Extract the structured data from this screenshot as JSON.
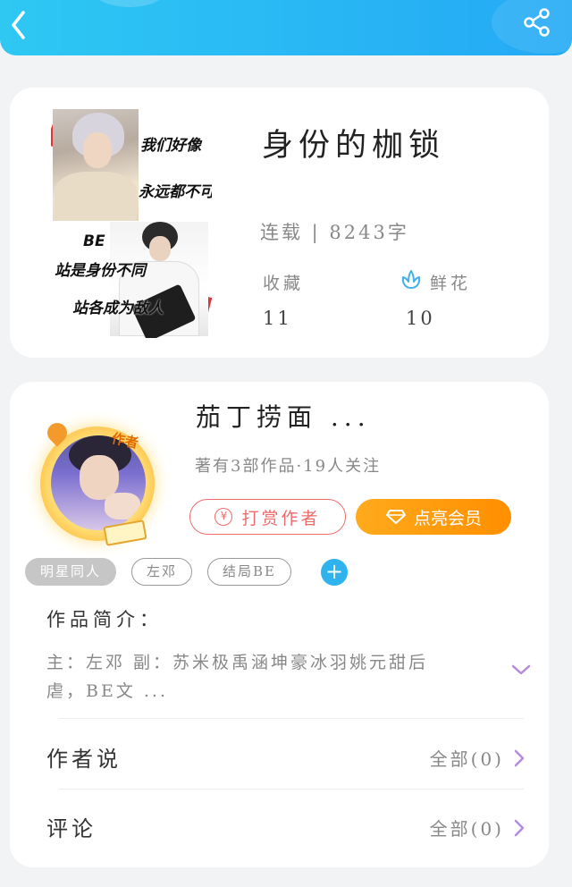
{
  "header": {
    "back_icon": "chevron-left-icon",
    "share_icon": "share-icon",
    "colors": {
      "start": "#2ec8f3",
      "end": "#24a9f5"
    }
  },
  "book": {
    "title": "身份的枷锁",
    "meta": "连载 | 8243字",
    "favorites_label": "收藏",
    "favorites_value": "11",
    "flowers_label": "鲜花",
    "flowers_value": "10",
    "cover_captions": [
      "我们好像",
      "永远都不可能",
      "BE",
      "站是身份不同",
      "站各成为敌人"
    ]
  },
  "author": {
    "name": "茄丁捞面 ...",
    "badge": "作者",
    "stats": "著有3部作品·19人关注",
    "tip_label": "打赏作者",
    "tip_icon": "¥",
    "vip_label": "点亮会员",
    "vip_color": "#ff9a10",
    "tags": [
      "明星同人",
      "左邓",
      "结局BE"
    ],
    "add_tag_icon": "+",
    "intro_title": "作品简介：",
    "intro_body": "主：左邓 副：苏米极禹涵坤豪冰羽姚元甜后虐，BE文 ...",
    "author_says_label": "作者说",
    "author_says_value": "全部(0)",
    "comments_label": "评论",
    "comments_value": "全部(0)",
    "accent_color": "#b58be0"
  }
}
